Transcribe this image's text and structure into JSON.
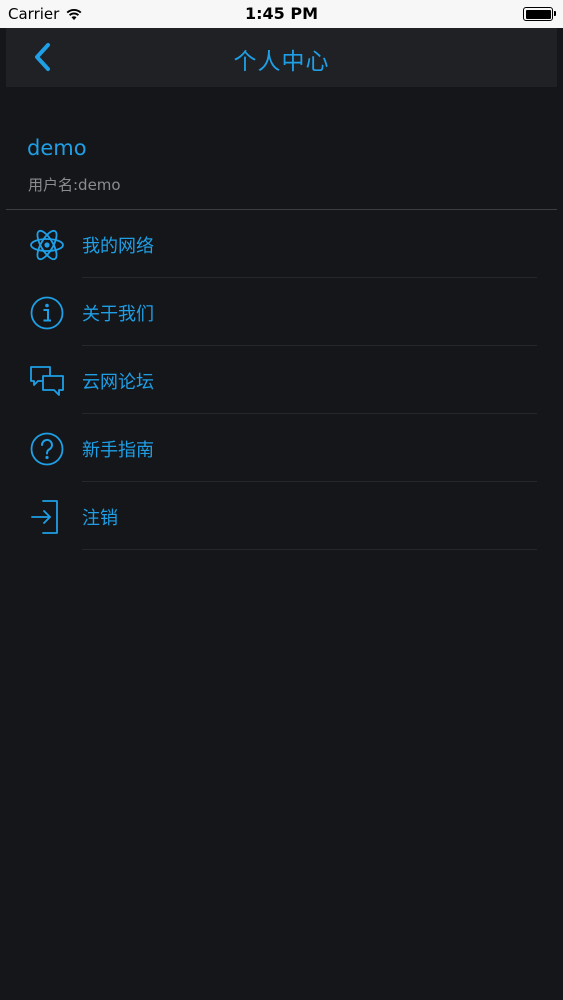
{
  "status_bar": {
    "carrier": "Carrier",
    "time": "1:45 PM",
    "battery_level": 1.0
  },
  "nav": {
    "back_icon": "chevron-left-icon",
    "title": "个人中心"
  },
  "user": {
    "name": "demo",
    "username_line": "用户名:demo"
  },
  "menu": {
    "items": [
      {
        "label": "我的网络",
        "icon": "atom-icon"
      },
      {
        "label": "关于我们",
        "icon": "info-icon"
      },
      {
        "label": "云网论坛",
        "icon": "chat-bubbles-icon"
      },
      {
        "label": "新手指南",
        "icon": "help-icon"
      },
      {
        "label": "注销",
        "icon": "logout-icon"
      }
    ]
  },
  "colors": {
    "background": "#15161a",
    "nav_background": "#202125",
    "accent": "#1e9fe6",
    "secondary_text": "#8b8c90",
    "divider": "#3d3e43"
  }
}
